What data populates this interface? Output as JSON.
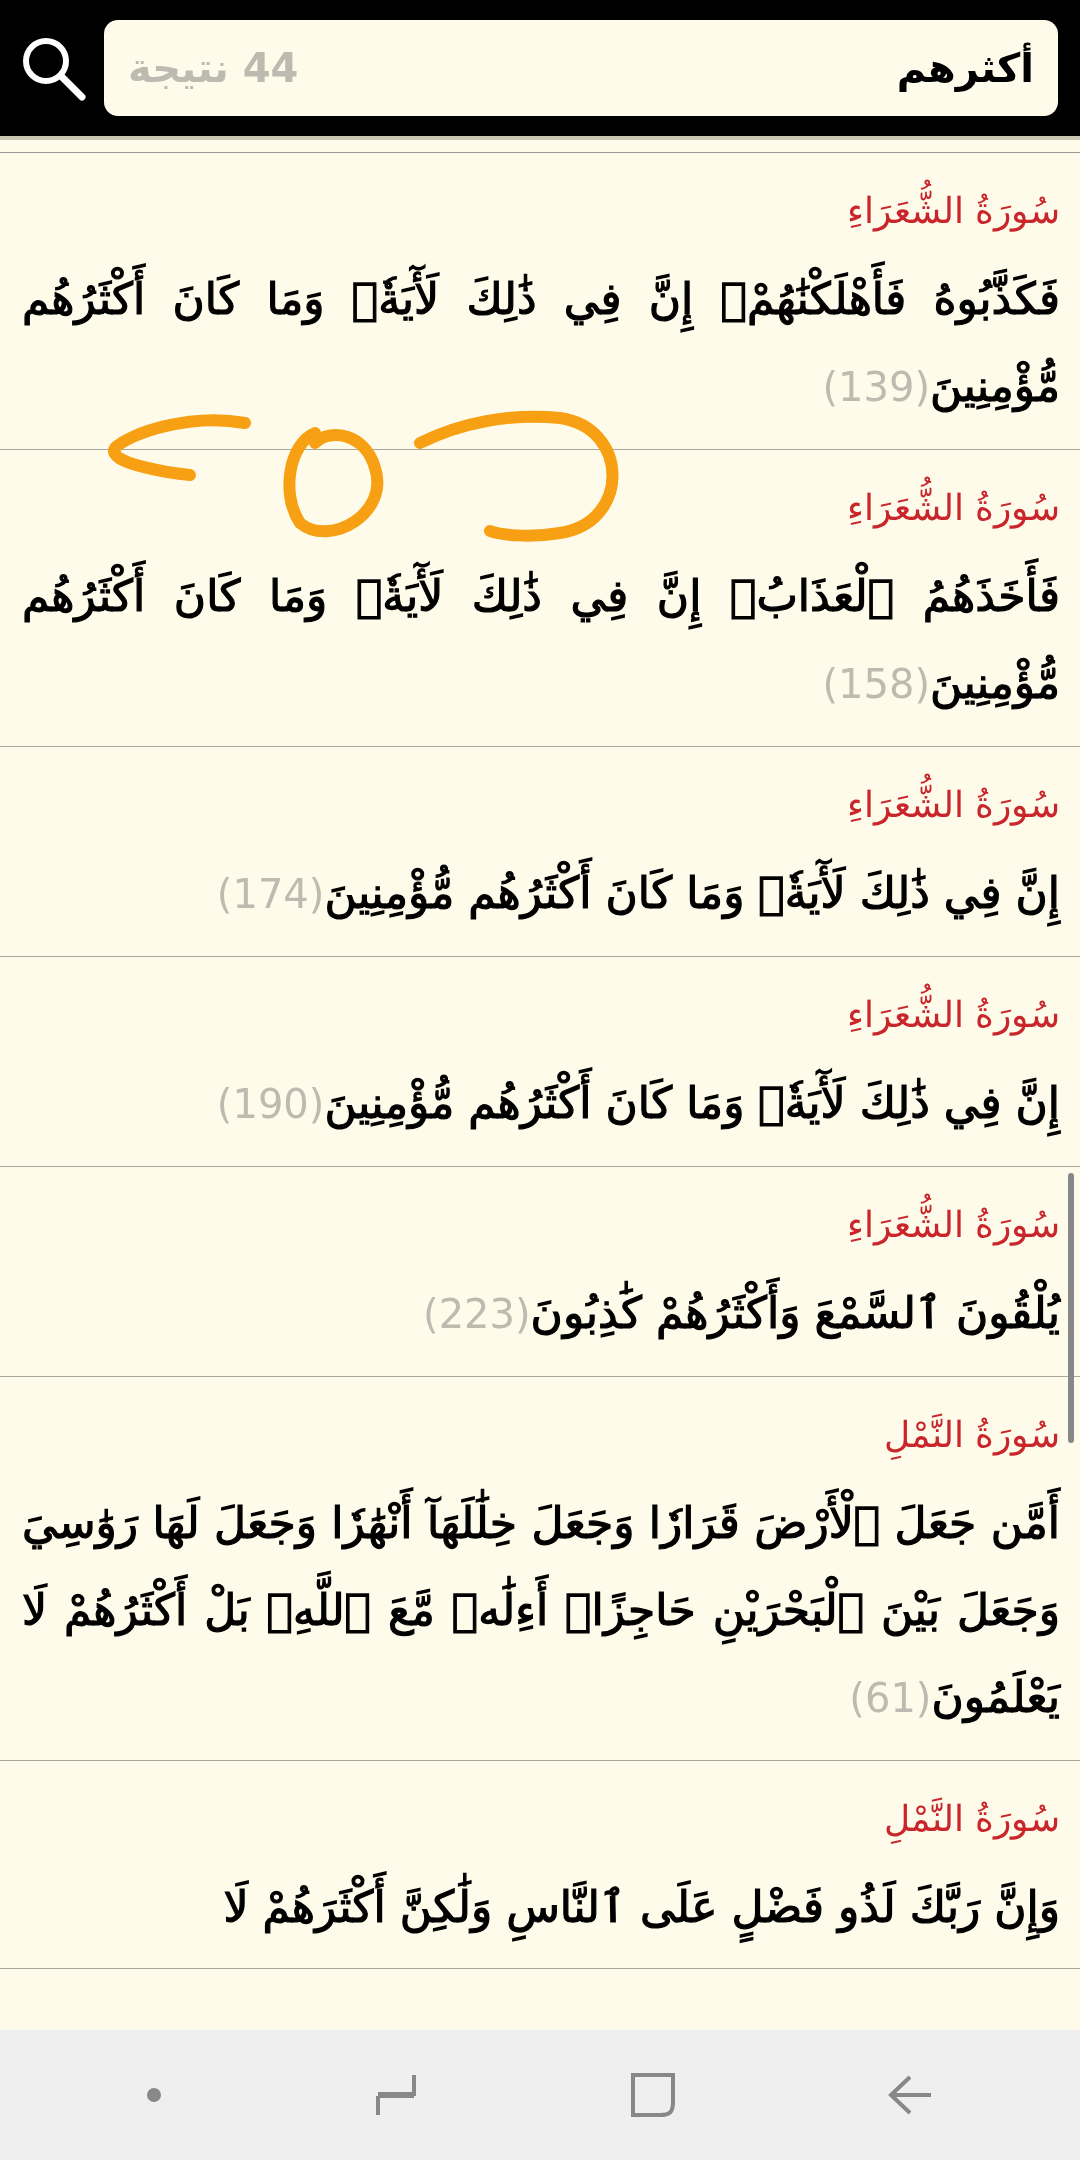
{
  "search": {
    "value": "أكثرهم",
    "result_count": "44 نتيجة"
  },
  "results": [
    {
      "surah": "سُورَةُ الشُّعَرَاءِ",
      "text": "فَكَذَّبُوهُ فَأَهْلَكْنَٰهُمْۗ إِنَّ فِي ذَٰلِكَ لَأٓيَةٗۖ وَمَا كَانَ أَكْثَرُهُم مُّؤْمِنِينَ",
      "number": "(139)"
    },
    {
      "surah": "سُورَةُ الشُّعَرَاءِ",
      "text": "فَأَخَذَهُمُ ٱلْعَذَابُۚ إِنَّ فِي ذَٰلِكَ لَأٓيَةٗۖ وَمَا كَانَ أَكْثَرُهُم مُّؤْمِنِينَ",
      "number": "(158)"
    },
    {
      "surah": "سُورَةُ الشُّعَرَاءِ",
      "text": "إِنَّ فِي ذَٰلِكَ لَأٓيَةٗۖ وَمَا كَانَ أَكْثَرُهُم مُّؤْمِنِينَ",
      "number": "(174)"
    },
    {
      "surah": "سُورَةُ الشُّعَرَاءِ",
      "text": "إِنَّ فِي ذَٰلِكَ لَأٓيَةٗۖ وَمَا كَانَ أَكْثَرُهُم مُّؤْمِنِينَ",
      "number": "(190)"
    },
    {
      "surah": "سُورَةُ الشُّعَرَاءِ",
      "text": "يُلْقُونَ ٱلسَّمْعَ وَأَكْثَرُهُمْ كَٰذِبُونَ",
      "number": "(223)"
    },
    {
      "surah": "سُورَةُ النَّمْلِ",
      "text": "أَمَّن جَعَلَ ٱلْأَرْضَ قَرَارٗا وَجَعَلَ خِلَٰلَهَآ أَنْهَٰرٗا وَجَعَلَ لَهَا رَوَٰسِيَ وَجَعَلَ بَيْنَ ٱلْبَحْرَيْنِ حَاجِزًاۗ أَءِلَٰهٞ مَّعَ ٱللَّهِۚ بَلْ أَكْثَرُهُمْ لَا يَعْلَمُونَ",
      "number": "(61)"
    },
    {
      "surah": "سُورَةُ النَّمْلِ",
      "text": "وَإِنَّ رَبَّكَ لَذُو فَضْلٍ عَلَى ٱلنَّاسِ وَلَٰكِنَّ أَكْثَرَهُمْ لَا"
    }
  ]
}
